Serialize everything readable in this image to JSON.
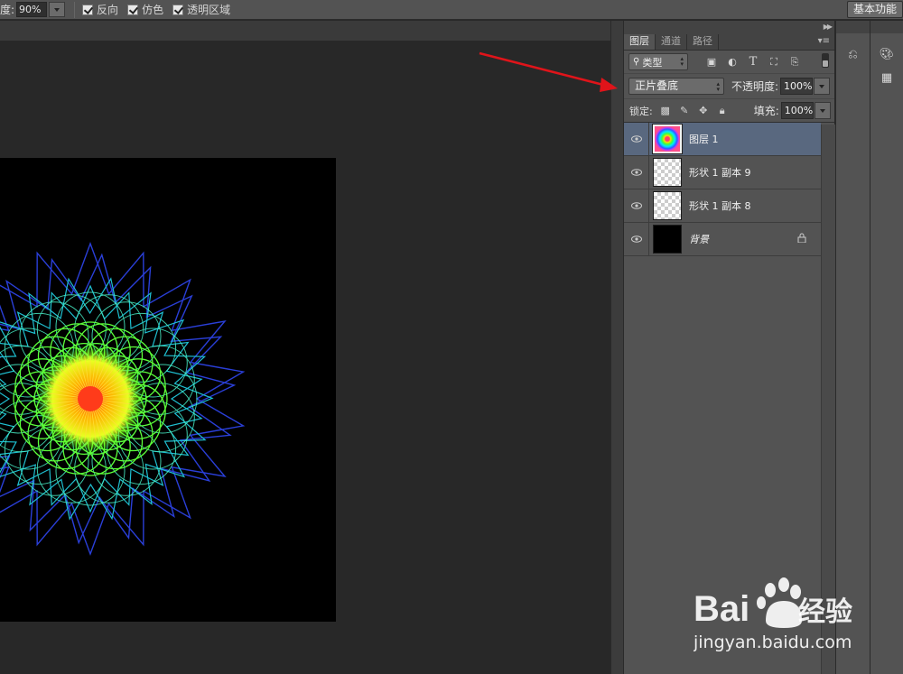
{
  "options_bar": {
    "opacity_label": "度:",
    "opacity_value": "90%",
    "checkboxes": [
      {
        "label": "反向",
        "checked": true
      },
      {
        "label": "仿色",
        "checked": true
      },
      {
        "label": "透明区域",
        "checked": true
      }
    ],
    "workspace_button": "基本功能"
  },
  "layers_panel": {
    "tabs": [
      "图层",
      "通道",
      "路径"
    ],
    "active_tab": "图层",
    "filter": {
      "kind_label": "类型",
      "filter_icons": [
        "image-filter-icon",
        "adjustment-filter-icon",
        "type-filter-icon",
        "shape-filter-icon",
        "smart-object-filter-icon"
      ]
    },
    "blend_mode": "正片叠底",
    "opacity_label": "不透明度:",
    "opacity_value": "100%",
    "lock_label": "锁定:",
    "lock_icons": [
      "lock-transparent-icon",
      "lock-image-icon",
      "lock-position-icon",
      "lock-all-icon"
    ],
    "fill_label": "填充:",
    "fill_value": "100%",
    "layers": [
      {
        "name": "图层 1",
        "thumb": "rainbow",
        "selected": true,
        "visible": true,
        "locked": false
      },
      {
        "name": "形状 1 副本 9",
        "thumb": "transparent",
        "selected": false,
        "visible": true,
        "locked": false
      },
      {
        "name": "形状 1 副本 8",
        "thumb": "transparent",
        "selected": false,
        "visible": true,
        "locked": false
      },
      {
        "name": "背景",
        "thumb": "black",
        "selected": false,
        "visible": true,
        "locked": true
      }
    ]
  },
  "watermark": {
    "brand_prefix": "Bai",
    "brand_suffix": "经验",
    "url": "jingyan.baidu.com"
  },
  "colors": {
    "annotation_arrow": "#e0141a",
    "selected_layer": "#59687f",
    "panel_bg": "#535353"
  }
}
